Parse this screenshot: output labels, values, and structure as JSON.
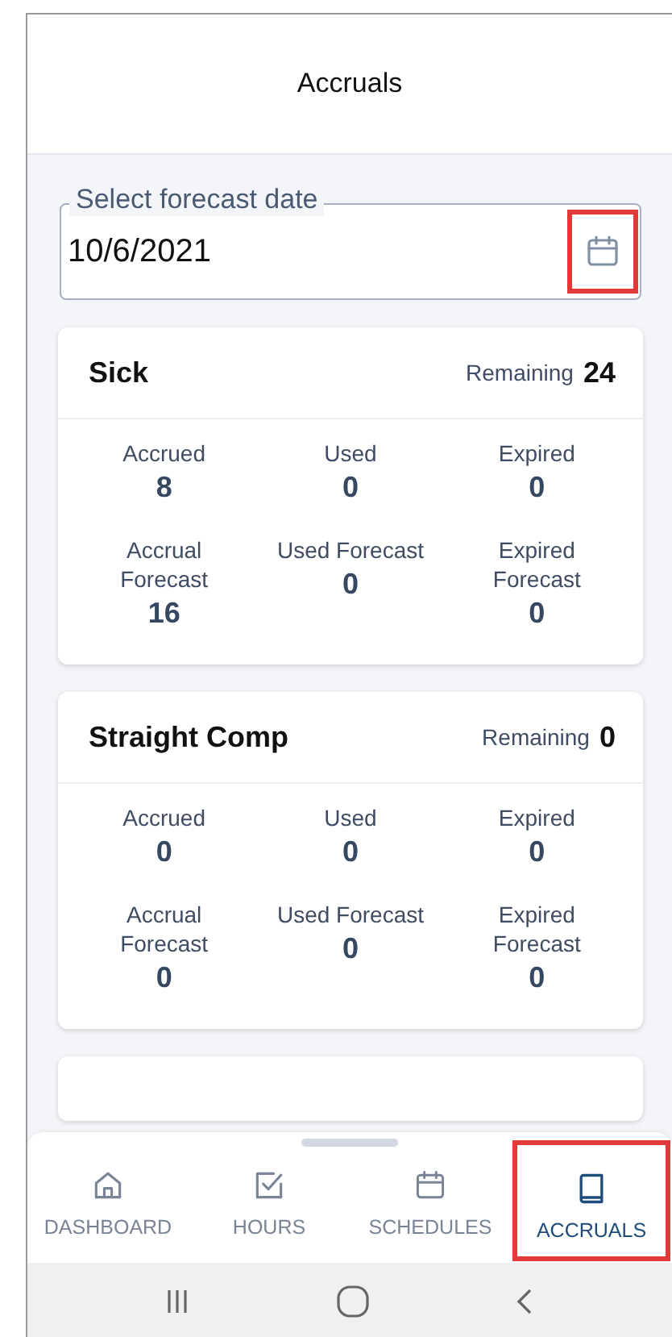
{
  "header": {
    "title": "Accruals"
  },
  "date_field": {
    "label": "Select forecast date",
    "value": "10/6/2021",
    "highlighted": true
  },
  "cards": [
    {
      "title": "Sick",
      "remaining_label": "Remaining",
      "remaining": "24",
      "stats": [
        {
          "label": "Accrued",
          "value": "8"
        },
        {
          "label": "Used",
          "value": "0"
        },
        {
          "label": "Expired",
          "value": "0"
        },
        {
          "label": "Accrual Forecast",
          "value": "16"
        },
        {
          "label": "Used Forecast",
          "value": "0"
        },
        {
          "label": "Expired Forecast",
          "value": "0"
        }
      ]
    },
    {
      "title": "Straight Comp",
      "remaining_label": "Remaining",
      "remaining": "0",
      "stats": [
        {
          "label": "Accrued",
          "value": "0"
        },
        {
          "label": "Used",
          "value": "0"
        },
        {
          "label": "Expired",
          "value": "0"
        },
        {
          "label": "Accrual Forecast",
          "value": "0"
        },
        {
          "label": "Used Forecast",
          "value": "0"
        },
        {
          "label": "Expired Forecast",
          "value": "0"
        }
      ]
    }
  ],
  "nav_tabs": [
    {
      "kind": "home",
      "label": "DASHBOARD",
      "selected": false,
      "highlighted": false
    },
    {
      "kind": "check",
      "label": "HOURS",
      "selected": false,
      "highlighted": false
    },
    {
      "kind": "calendar",
      "label": "SCHEDULES",
      "selected": false,
      "highlighted": false
    },
    {
      "kind": "book",
      "label": "ACCRUALS",
      "selected": true,
      "highlighted": true
    }
  ]
}
